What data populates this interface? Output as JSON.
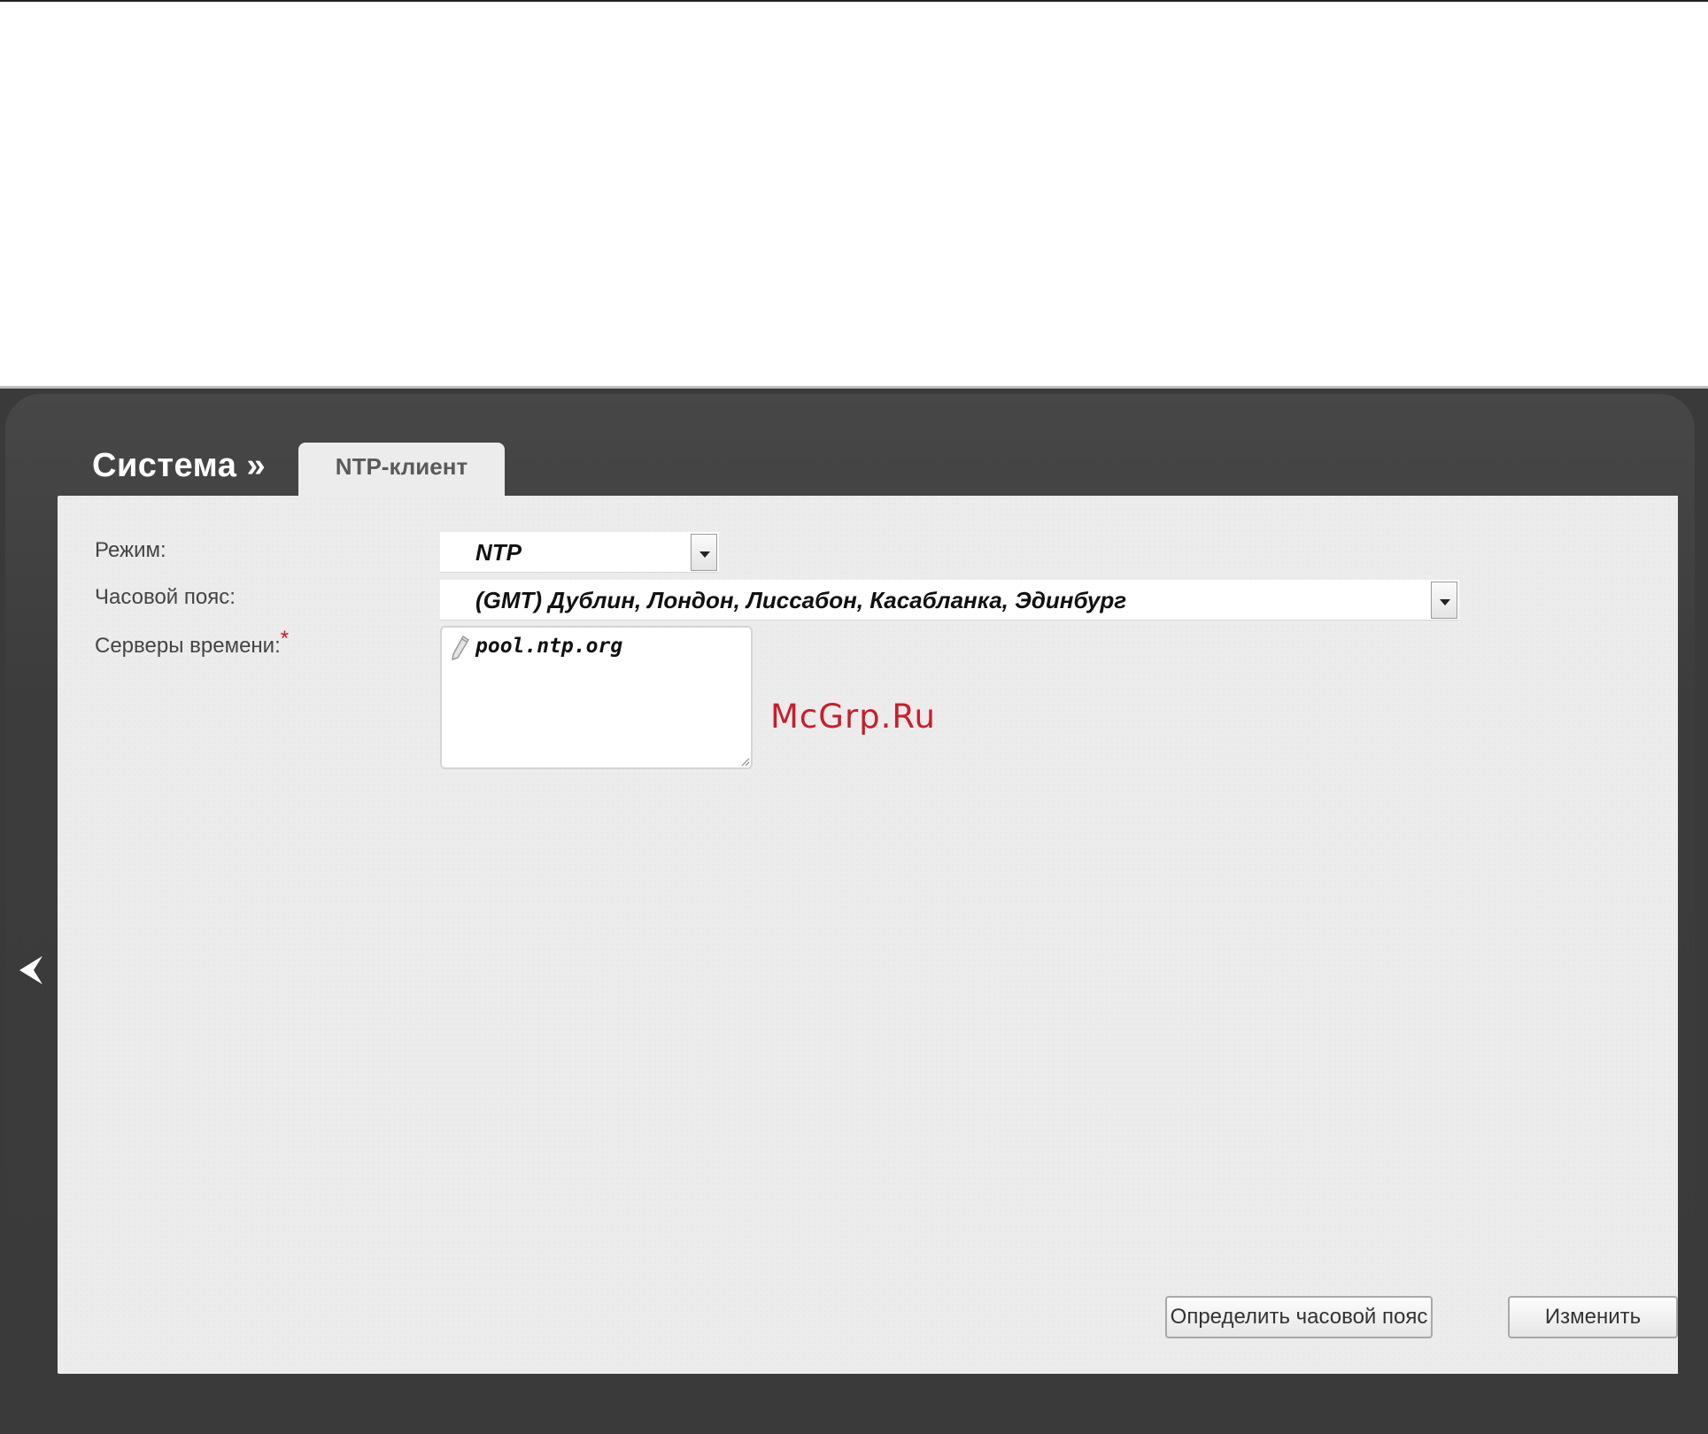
{
  "header": {
    "section_title": "Система »",
    "active_tab": "NTP-клиент"
  },
  "form": {
    "mode": {
      "label": "Режим:",
      "value": "NTP"
    },
    "timezone": {
      "label": "Часовой пояс:",
      "value": "(GMT) Дублин, Лондон, Лиссабон, Касабланка, Эдинбург"
    },
    "servers": {
      "label": "Серверы времени:",
      "required_mark": "*",
      "value": "pool.ntp.org"
    }
  },
  "watermark": "McGrp.Ru",
  "actions": {
    "detect_timezone_label": "Определить часовой пояс",
    "change_label": "Изменить"
  },
  "icons": {
    "collapse": "chevron-left-icon",
    "edit": "pencil-icon",
    "dropdown": "chevron-down-icon"
  },
  "colors": {
    "frame": "#3a3a3a",
    "panel": "#ececec",
    "required": "#d0141c",
    "watermark": "#c81e2c"
  }
}
